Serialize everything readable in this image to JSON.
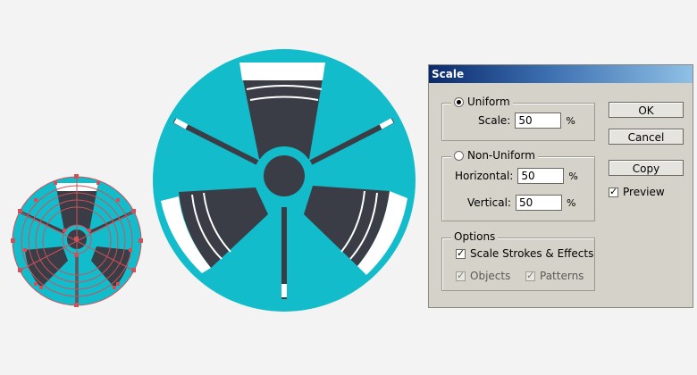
{
  "dialog": {
    "title": "Scale",
    "uniform": {
      "label": "Uniform",
      "selected": true,
      "scale_label": "Scale:",
      "scale_value": "50",
      "unit": "%"
    },
    "non_uniform": {
      "label": "Non-Uniform",
      "selected": false,
      "horizontal_label": "Horizontal:",
      "horizontal_value": "50",
      "vertical_label": "Vertical:",
      "vertical_value": "50",
      "unit": "%"
    },
    "options": {
      "label": "Options",
      "scale_strokes": {
        "label": "Scale Strokes & Effects",
        "checked": true
      },
      "objects": {
        "label": "Objects",
        "checked": true
      },
      "patterns": {
        "label": "Patterns",
        "checked": true
      }
    },
    "buttons": {
      "ok": "OK",
      "cancel": "Cancel",
      "copy": "Copy"
    },
    "preview": {
      "label": "Preview",
      "checked": true
    }
  },
  "colors": {
    "teal": "#12bccb",
    "dark": "#3a3d45",
    "white": "#ffffff",
    "selection": "#d0505a",
    "background": "#f3f3f3"
  },
  "artwork": {
    "icons": [
      "fan-icon-selected-small",
      "fan-icon-large"
    ]
  }
}
